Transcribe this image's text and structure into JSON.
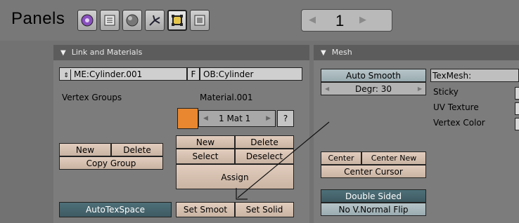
{
  "header": {
    "title": "Panels",
    "context_buttons": [
      {
        "name": "logic-context-icon"
      },
      {
        "name": "script-context-icon"
      },
      {
        "name": "shading-context-icon"
      },
      {
        "name": "object-context-icon"
      },
      {
        "name": "editing-context-icon"
      },
      {
        "name": "scene-context-icon"
      }
    ],
    "page_number": "1"
  },
  "link_materials": {
    "title": "Link and Materials",
    "mesh_field": "ME:Cylinder.001",
    "fake_user": "F",
    "object_field": "OB:Cylinder",
    "vertex_groups_label": "Vertex Groups",
    "material_label": "Material.001",
    "material_color": "#e8872f",
    "mat_counter": "1 Mat 1",
    "question": "?",
    "vg_new": "New",
    "vg_delete": "Delete",
    "copy_group": "Copy Group",
    "mat_new": "New",
    "mat_delete": "Delete",
    "select": "Select",
    "deselect": "Deselect",
    "assign": "Assign",
    "autotexspace": "AutoTexSpace",
    "set_smooth": "Set Smoot",
    "set_solid": "Set Solid"
  },
  "mesh": {
    "title": "Mesh",
    "auto_smooth": "Auto Smooth",
    "degr": "Degr: 30",
    "texmesh": "TexMesh:",
    "sticky": "Sticky",
    "uv_texture": "UV Texture",
    "vertex_color": "Vertex Color",
    "center": "Center",
    "center_new": "Center New",
    "center_cursor": "Center Cursor",
    "double_sided": "Double Sided",
    "no_vnormal_flip": "No V.Normal Flip"
  }
}
